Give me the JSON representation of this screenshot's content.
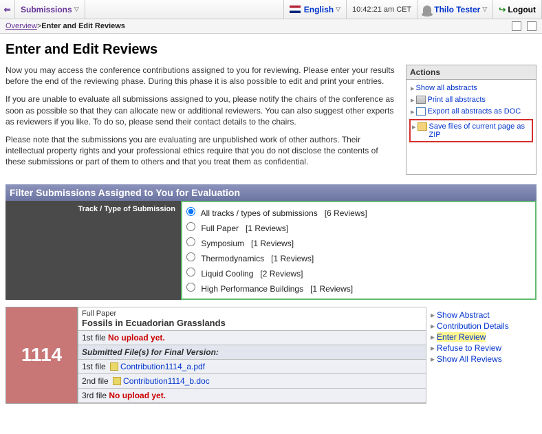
{
  "topbar": {
    "submissions": "Submissions",
    "language": "English",
    "clock": "10:42:21 am CET",
    "user": "Thilo Tester",
    "logout": "Logout"
  },
  "breadcrumb": {
    "overview": "Overview",
    "sep": " > ",
    "current": "Enter and Edit Reviews"
  },
  "page_title": "Enter and Edit Reviews",
  "intro": {
    "p1": "Now you may access the conference contributions assigned to you for reviewing. Please enter your results before the end of the reviewing phase. During this phase it is also possible to edit and print your entries.",
    "p2": "If you are unable to evaluate all submissions assigned to you, please notify the chairs of the conference as soon as possible so that they can allocate new or additional reviewers. You can also suggest other experts as reviewers if you like. To do so, please send their contact details to the chairs.",
    "p3": "Please note that the submissions you are evaluating are unpublished work of other authors. Their intellectual property rights and your professional ethics require that you do not disclose the contents of these submissions or part of them to others and that you treat them as confidential."
  },
  "actions": {
    "header": "Actions",
    "items": {
      "show_all": "Show all abstracts",
      "print_all": "Print all abstracts",
      "export_doc": "Export all abstracts as DOC",
      "save_zip": "Save files of current page as ZIP"
    }
  },
  "filter": {
    "header": "Filter Submissions Assigned to You for Evaluation",
    "label": "Track / Type of Submission",
    "options": [
      {
        "label": "All tracks / types of submissions",
        "count": "[6 Reviews]",
        "selected": true
      },
      {
        "label": "Full Paper",
        "count": "[1 Reviews]",
        "selected": false
      },
      {
        "label": "Symposium",
        "count": "[1 Reviews]",
        "selected": false
      },
      {
        "label": "Thermodynamics",
        "count": "[1 Reviews]",
        "selected": false
      },
      {
        "label": "Liquid Cooling",
        "count": "[2 Reviews]",
        "selected": false
      },
      {
        "label": "High Performance Buildings",
        "count": "[1 Reviews]",
        "selected": false
      }
    ]
  },
  "submission": {
    "id": "1114",
    "type": "Full Paper",
    "title": "Fossils in Ecuadorian Grasslands",
    "first_file_label": "1st file",
    "no_upload": "No upload yet.",
    "final_header": "Submitted File(s) for Final Version:",
    "files": [
      {
        "label": "1st file",
        "name": "Contribution1114_a.pdf"
      },
      {
        "label": "2nd file",
        "name": "Contribution1114_b.doc"
      },
      {
        "label": "3rd file",
        "name": null
      }
    ],
    "actions": {
      "show_abstract": "Show Abstract",
      "contrib_details": "Contribution Details",
      "enter_review": "Enter Review",
      "refuse": "Refuse to Review",
      "show_all_rev": "Show All Reviews"
    }
  }
}
